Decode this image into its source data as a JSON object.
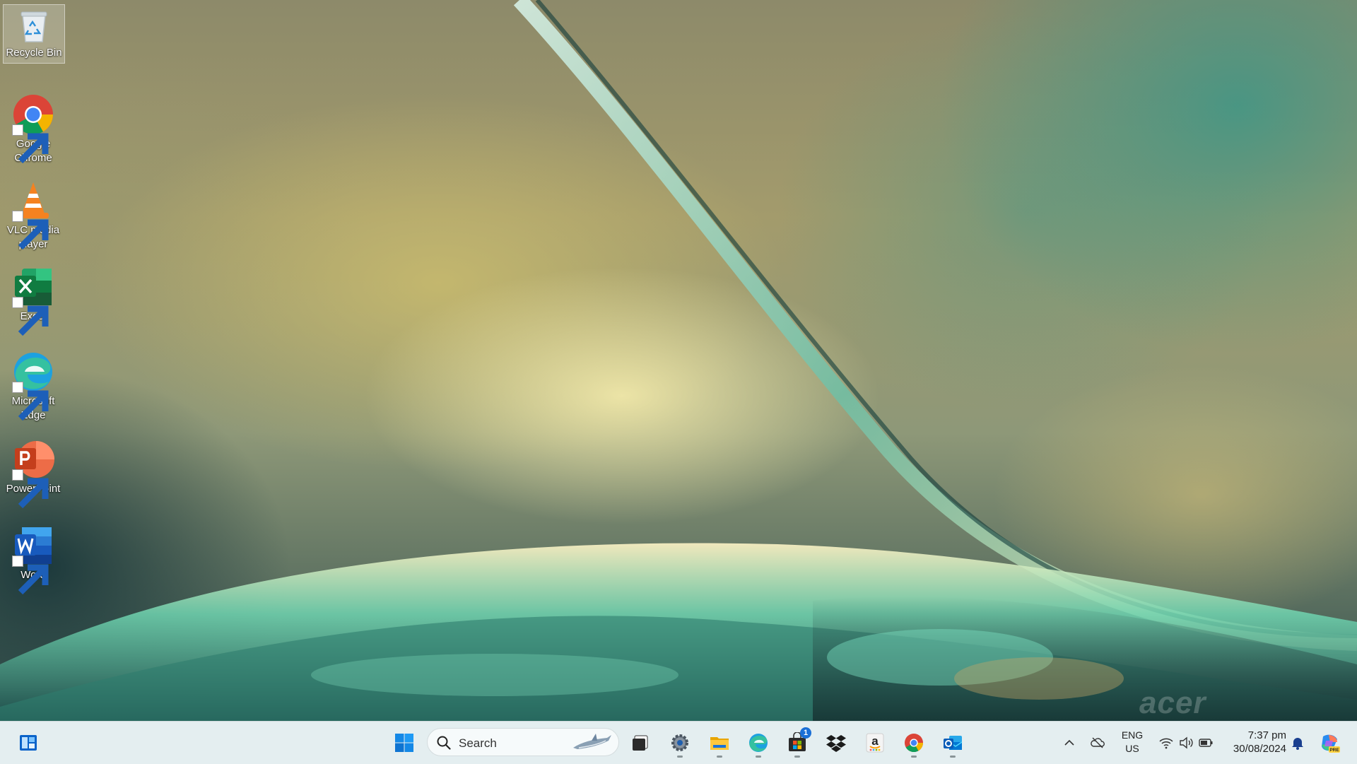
{
  "desktop": {
    "icons": [
      {
        "label": "Recycle Bin",
        "icon": "recycle-bin-icon",
        "selected": true
      },
      {
        "label": "Google\nChrome",
        "icon": "chrome-icon"
      },
      {
        "label": "VLC media\nplayer",
        "icon": "vlc-icon"
      },
      {
        "label": "Excel",
        "icon": "excel-icon"
      },
      {
        "label": "Microsoft\nEdge",
        "icon": "edge-icon"
      },
      {
        "label": "PowerPoint",
        "icon": "powerpoint-icon"
      },
      {
        "label": "Word",
        "icon": "word-icon"
      }
    ],
    "watermark": "acer"
  },
  "taskbar": {
    "widgets_icon": "widgets-icon",
    "start_icon": "windows-start-icon",
    "search": {
      "placeholder": "Search"
    },
    "pinned": [
      {
        "name": "Task View",
        "icon": "task-view-icon",
        "running": false
      },
      {
        "name": "Settings",
        "icon": "settings-gear-icon",
        "running": true
      },
      {
        "name": "File Explorer",
        "icon": "file-explorer-icon",
        "running": true
      },
      {
        "name": "Microsoft Edge",
        "icon": "edge-icon",
        "running": true
      },
      {
        "name": "Microsoft Store",
        "icon": "store-icon",
        "running": true,
        "badge": "1"
      },
      {
        "name": "Dropbox",
        "icon": "dropbox-icon",
        "running": false
      },
      {
        "name": "Amazon",
        "icon": "amazon-icon",
        "running": false
      },
      {
        "name": "Google Chrome",
        "icon": "chrome-icon",
        "running": true
      },
      {
        "name": "Outlook",
        "icon": "outlook-icon",
        "running": true
      }
    ],
    "tray": {
      "chevron_icon": "chevron-up-icon",
      "onedrive_icon": "cloud-offline-icon",
      "language": {
        "line1": "ENG",
        "line2": "US"
      },
      "wifi_icon": "wifi-icon",
      "volume_icon": "volume-icon",
      "battery_icon": "battery-icon",
      "time": "7:37 pm",
      "date": "30/08/2024",
      "notification_icon": "bell-icon",
      "copilot_icon": "copilot-icon",
      "copilot_badge": "PRE"
    }
  },
  "colors": {
    "taskbar_bg": "#e4eef0",
    "accent": "#1a6fd6"
  }
}
